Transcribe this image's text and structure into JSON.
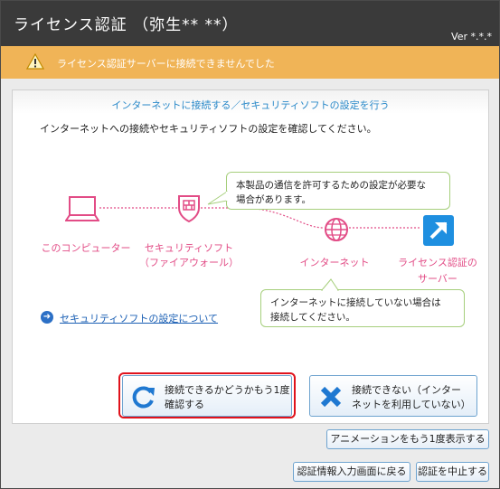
{
  "window": {
    "title": "ライセンス認証 （弥生** **）",
    "version": "Ver *.*.*"
  },
  "warning": {
    "text": "ライセンス認証サーバーに接続できませんでした"
  },
  "panel": {
    "heading": "インターネットに接続する／セキュリティソフトの設定を行う",
    "description": "インターネットへの接続やセキュリティソフトの設定を確認してください。"
  },
  "diagram": {
    "computer_label": "このコンピューター",
    "firewall_label_1": "セキュリティソフト",
    "firewall_label_2": "（ファイアウォール）",
    "internet_label": "インターネット",
    "server_label_1": "ライセンス認証の",
    "server_label_2": "サーバー",
    "bubble_top_1": "本製品の通信を許可するための設定が必要な",
    "bubble_top_2": "場合があります。",
    "bubble_bottom_1": "インターネットに接続していない場合は",
    "bubble_bottom_2": "接続してください。"
  },
  "link": {
    "text": "セキュリティソフトの設定について"
  },
  "buttons": {
    "retry_1": "接続できるかどうかもう1度",
    "retry_2": "確認する",
    "cannot_1": "接続できない（インター",
    "cannot_2": "ネットを利用していない）",
    "replay": "アニメーションをもう1度表示する",
    "back": "認証情報入力画面に戻る",
    "cancel": "認証を中止する"
  },
  "colors": {
    "accent": "#2a89c9",
    "warning": "#f0b457",
    "diagram": "#e24c86",
    "highlight": "#e0121b"
  }
}
